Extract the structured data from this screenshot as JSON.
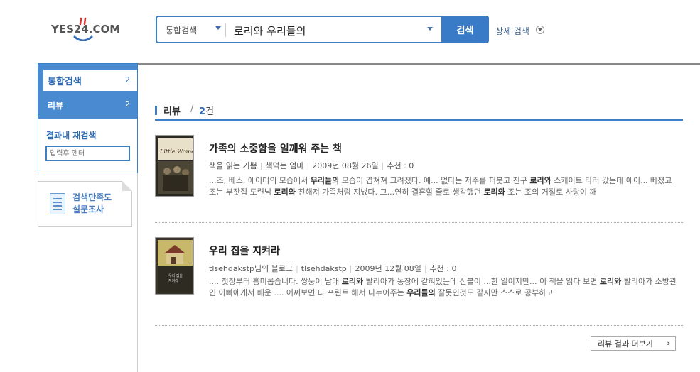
{
  "header": {
    "logo_text": "YES24.COM",
    "search_scope": "통합검색",
    "search_query": "로리와 우리들의",
    "search_button": "검색",
    "advanced_search": "상세 검색"
  },
  "sidebar": {
    "nav": [
      {
        "label": "통합검색",
        "count": "2"
      },
      {
        "label": "리뷰",
        "count": "2"
      }
    ],
    "refine_title": "결과내 재검색",
    "refine_placeholder": "입력후 엔터",
    "survey_line1": "검색만족도",
    "survey_line2": "설문조사"
  },
  "section": {
    "title": "리뷰",
    "sep": "/",
    "count": "2",
    "count_unit": "건"
  },
  "results": [
    {
      "title": "가족의 소중함을 일깨워 주는 책",
      "blog": "책을 읽는 기쁨",
      "author": "책먹는 엄마",
      "date": "2009년 08월 26일",
      "recommend": "추천 : 0",
      "snippet_parts": [
        "...조, 베스, 에이미의 모습에서 ",
        "우리들의",
        " 모습이 겹쳐져 그려졌다. 예... 없다는 저주를 퍼붓고 친구 ",
        "로리와",
        " 스케이트 타러 갔는데 에이... 빠졌고 조는 부잣집 도련님 ",
        "로리와",
        " 친해져 가족처럼 지냈다. 그...연히 결혼할 줄로 생각했던 ",
        "로리와",
        " 조는 조의 거절로 사랑이 깨"
      ]
    },
    {
      "title": "우리 집을 지켜라",
      "blog": "tlsehdakstp님의 블로그",
      "author": "tlsehdakstp",
      "date": "2009년 12월 08일",
      "recommend": "추천 : 0",
      "snippet_parts": [
        ".... 첫장부터 흥미롭습니다. 쌍둥이 남매 ",
        "로리와",
        " 탈리아가 농장에 갇혀있는데 산불이 ...한 일이지만...  이 책을 읽다 보면 ",
        "로리와",
        " 탈리아가 소방관인 아빠에게서 배운 .... 어찌보면 다 프린트 해서 나누어주는 ",
        "우리들의",
        " 잘못인것도 같지만 스스로 공부하고"
      ]
    }
  ],
  "more_button": "리뷰 결과 더보기",
  "colors": {
    "accent": "#3c7fc4",
    "nav_active_bg": "#4a8ad0",
    "search_button_bg": "#3a7bc8"
  }
}
